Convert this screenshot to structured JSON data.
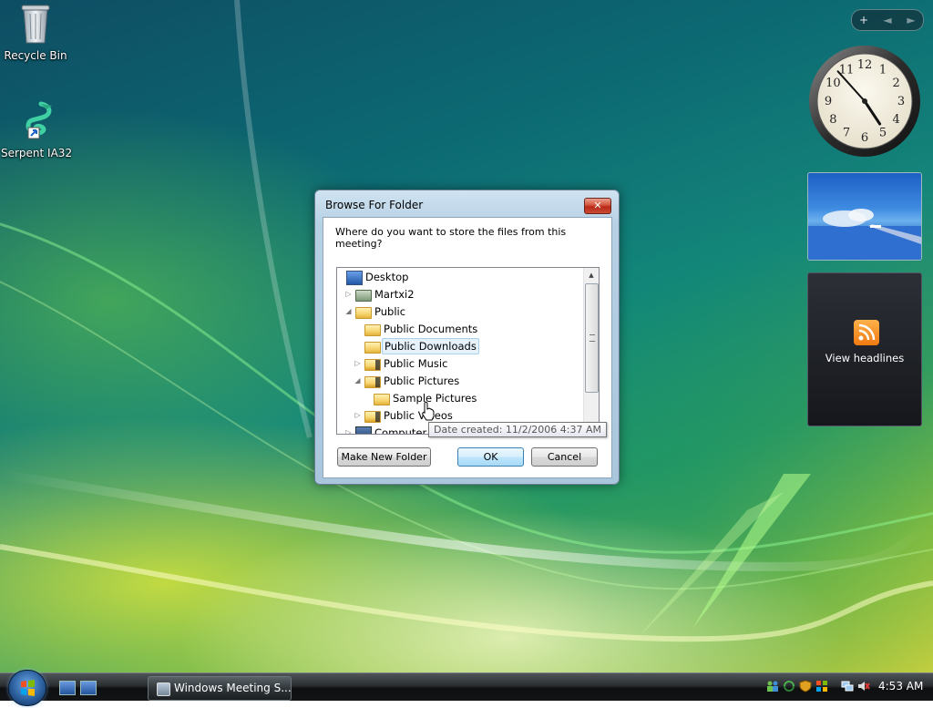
{
  "desktop": {
    "icons": [
      {
        "label": "Recycle Bin",
        "icon": "recycle-bin-icon"
      },
      {
        "label": "Serpent IA32",
        "icon": "serpent-shortcut-icon"
      }
    ]
  },
  "sidebar": {
    "controls": {
      "add": "+",
      "prev": "◄",
      "next": "►"
    },
    "clock_numbers": [
      "12",
      "1",
      "2",
      "3",
      "4",
      "5",
      "6",
      "7",
      "8",
      "9",
      "10",
      "11"
    ],
    "clock_time": {
      "hour": 4,
      "minute": 53
    },
    "feeds_label": "View headlines"
  },
  "dialog": {
    "title": "Browse For Folder",
    "close_label": "✕",
    "prompt": "Where do you want to store the files from this meeting?",
    "tree": [
      {
        "label": "Desktop",
        "icon": "desktop-icon",
        "expander": ""
      },
      {
        "label": "Martxi2",
        "icon": "user-folder-icon",
        "expander": "▷"
      },
      {
        "label": "Public",
        "icon": "folder-icon",
        "expander": "◢"
      },
      {
        "label": "Public Documents",
        "icon": "folder-icon",
        "expander": ""
      },
      {
        "label": "Public Downloads",
        "icon": "folder-icon",
        "expander": "",
        "selected": true
      },
      {
        "label": "Public Music",
        "icon": "music-folder-icon",
        "expander": "▷"
      },
      {
        "label": "Public Pictures",
        "icon": "pictures-folder-icon",
        "expander": "◢"
      },
      {
        "label": "Sample Pictures",
        "icon": "folder-icon",
        "expander": ""
      },
      {
        "label": "Public Videos",
        "icon": "videos-folder-icon",
        "expander": "▷"
      },
      {
        "label": "Computer",
        "icon": "computer-icon",
        "expander": "▷"
      }
    ],
    "tooltip": "Date created: 11/2/2006 4:37 AM",
    "buttons": {
      "make_new_folder": "Make New Folder",
      "ok": "OK",
      "cancel": "Cancel"
    }
  },
  "taskbar": {
    "task_button": "Windows Meeting S...",
    "time": "4:53 AM"
  },
  "colors": {
    "accent": "#3c7fb1",
    "selection": "#e6f2fb",
    "close": "#c84b33"
  }
}
